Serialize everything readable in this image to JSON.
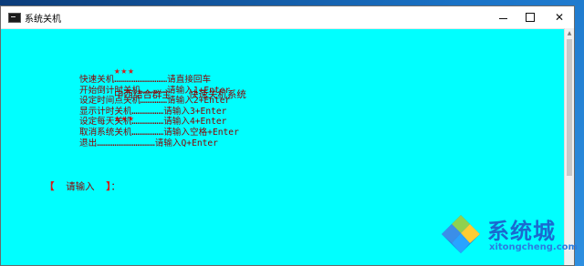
{
  "window": {
    "title": "系统关机",
    "minimize_glyph": "—",
    "maximize_glyph": "□",
    "close_glyph": "✕"
  },
  "console": {
    "stars_left": "★★★",
    "header_text": "中西结合群主   快速关机系统",
    "stars_right": "★★★",
    "menu": [
      {
        "label": "快速关机",
        "dots": "…………………………",
        "hint": "请直接回车"
      },
      {
        "label": "开始倒计时关机",
        "dots": "……………",
        "hint": "请输入1+Enter"
      },
      {
        "label": "设定时间点关机",
        "dots": "……………",
        "hint": "请输入2+Enter"
      },
      {
        "label": "显示计时关机",
        "dots": "………………",
        "hint": "请输入3+Enter"
      },
      {
        "label": "设定每天关机",
        "dots": "………………",
        "hint": "请输入4+Enter"
      },
      {
        "label": "取消系统关机",
        "dots": "………………",
        "hint": "请输入空格+Enter"
      },
      {
        "label": "退出",
        "dots": "……………………………",
        "hint": "请输入Q+Enter"
      }
    ],
    "prompt_open": "【",
    "prompt_label": "  请输入  ",
    "prompt_close": "】",
    "prompt_colon": "："
  },
  "watermark": {
    "brand": "系统城",
    "url": "xitongcheng.com"
  },
  "colors": {
    "console_bg": "#00ffff",
    "text": "#8b0000",
    "stars": "#d71919",
    "watermark": "#1a6ad0"
  }
}
